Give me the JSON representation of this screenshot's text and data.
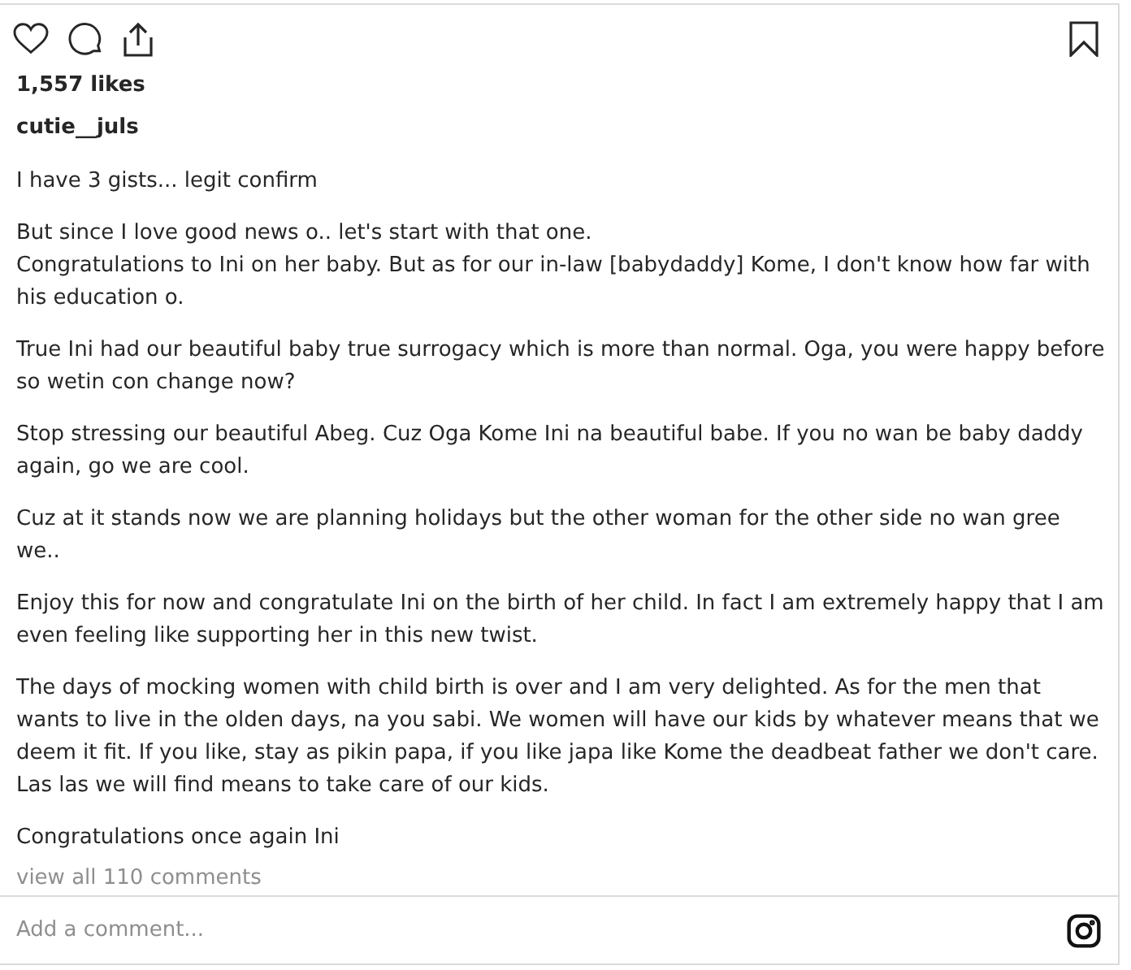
{
  "likes": "1,557 likes",
  "username": "cutie__juls",
  "caption": [
    "I have 3 gists... legit confirm",
    "But since I love good news o.. let's start with that one.\nCongratulations to Ini on her baby. But as for our in-law [babydaddy] Kome, I don't know how far with his education o.",
    "True Ini had our beautiful baby true surrogacy which is more than normal. Oga, you were happy before so wetin con change now?",
    "Stop stressing our beautiful Abeg. Cuz Oga Kome Ini na beautiful babe. If you no wan be baby daddy again, go we are cool.",
    "Cuz at it stands now we are planning holidays but the other woman for the other side no wan gree we..",
    "Enjoy this for now and congratulate Ini on the birth of her child. In fact I am extremely happy that I am even feeling like supporting her in this new twist.",
    "The days of mocking women with child birth is over and I am very delighted. As for the men that wants to live in the olden days, na you sabi. We women will have our kids by whatever means that we deem it fit. If you like, stay as pikin papa, if you like japa like Kome the deadbeat father we don't care. Las las we will find means to take care of our kids.",
    "Congratulations once again Ini"
  ],
  "view_comments": "view all 110 comments",
  "comment": {
    "placeholder": "Add a comment..."
  }
}
